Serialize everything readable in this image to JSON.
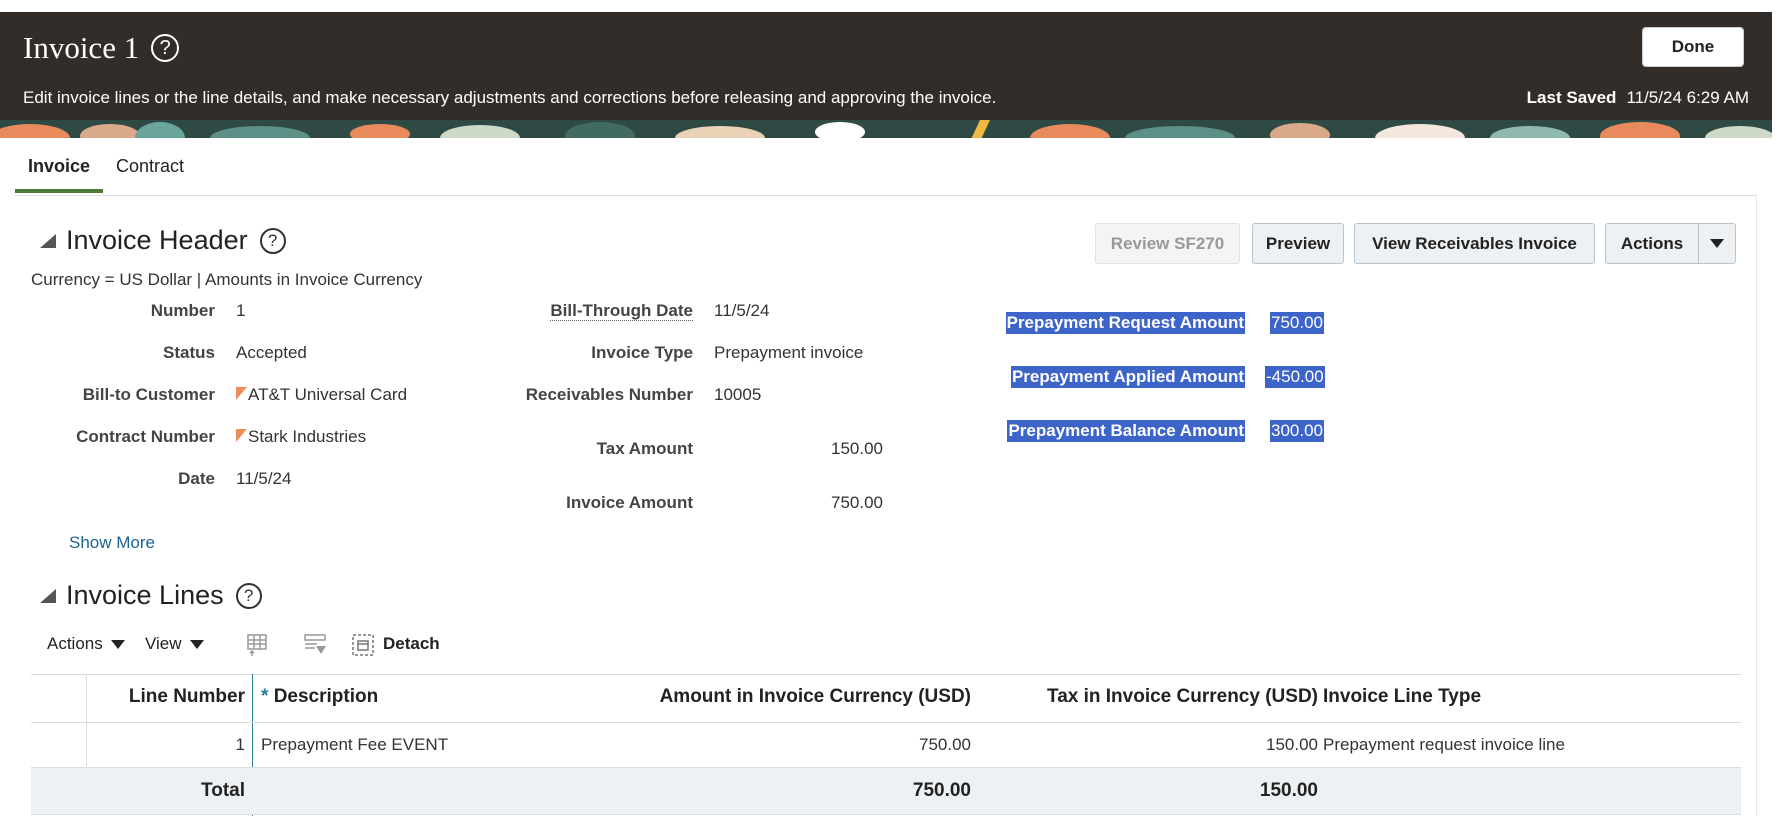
{
  "header": {
    "title": "Invoice 1",
    "description": "Edit invoice lines or the line details, and make necessary adjustments and corrections before releasing and approving the invoice.",
    "done_label": "Done",
    "last_saved_label": "Last Saved",
    "last_saved_value": "11/5/24 6:29 AM"
  },
  "tabs": [
    {
      "label": "Invoice",
      "active": true
    },
    {
      "label": "Contract",
      "active": false
    }
  ],
  "invoice_header": {
    "title": "Invoice Header",
    "currency_note": "Currency = US Dollar | Amounts in Invoice Currency",
    "buttons": {
      "review": "Review SF270",
      "preview": "Preview",
      "view_receivables": "View Receivables Invoice",
      "actions": "Actions"
    },
    "fields_left": [
      {
        "label": "Number",
        "value": "1"
      },
      {
        "label": "Status",
        "value": "Accepted"
      },
      {
        "label": "Bill-to Customer",
        "value": "AT&T Universal Card"
      },
      {
        "label": "Contract Number",
        "value": "Stark Industries"
      },
      {
        "label": "Date",
        "value": "11/5/24"
      }
    ],
    "fields_mid": [
      {
        "label": "Bill-Through Date",
        "value": "11/5/24"
      },
      {
        "label": "Invoice Type",
        "value": "Prepayment invoice"
      },
      {
        "label": "Receivables Number",
        "value": "10005"
      },
      {
        "label": "Tax Amount",
        "value": "150.00"
      },
      {
        "label": "Invoice Amount",
        "value": "750.00"
      }
    ],
    "fields_right": [
      {
        "label": "Prepayment Request Amount",
        "value": "750.00"
      },
      {
        "label": "Prepayment Applied Amount",
        "value": "-450.00"
      },
      {
        "label": "Prepayment Balance Amount",
        "value": "300.00"
      }
    ],
    "show_more": "Show More"
  },
  "invoice_lines": {
    "title": "Invoice Lines",
    "toolbar": {
      "actions": "Actions",
      "view": "View",
      "detach": "Detach"
    },
    "columns": [
      "Line Number",
      "Description",
      "Amount in Invoice Currency (USD)",
      "Tax in Invoice Currency (USD)",
      "Invoice Line Type"
    ],
    "required_marker": "*",
    "rows": [
      {
        "line_number": "1",
        "description": "Prepayment Fee EVENT",
        "amount": "750.00",
        "tax": "150.00",
        "type": "Prepayment request invoice line"
      }
    ],
    "total": {
      "label": "Total",
      "amount": "750.00",
      "tax": "150.00"
    }
  },
  "colors": {
    "banner": "#332d2a",
    "selection": "#3d64c9",
    "active_tab": "#4e7a3c",
    "link": "#196490",
    "total_row": "#eef1f4"
  }
}
